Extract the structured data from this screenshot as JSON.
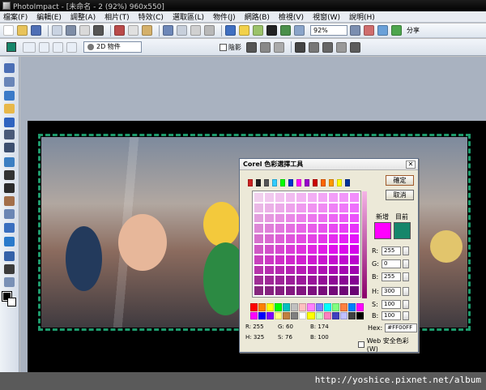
{
  "window": {
    "title": "PhotoImpact - [未命名 - 2 (92%) 960x550]"
  },
  "menu": [
    "檔案(F)",
    "編輯(E)",
    "調整(A)",
    "相片(T)",
    "特效(C)",
    "選取區(L)",
    "物件(J)",
    "網路(B)",
    "檢視(V)",
    "視窗(W)",
    "說明(H)"
  ],
  "toolbar": {
    "zoom_value": "92%",
    "share_label": "分享"
  },
  "attr_toolbar": {
    "object_mode": "2D 物件",
    "shadow_label": "陰影"
  },
  "dialog": {
    "title": "Corel 色彩選擇工具",
    "close_glyph": "✕",
    "ok_label": "確定",
    "cancel_label": "取消",
    "new_label": "新增",
    "current_label": "目前",
    "fields": [
      {
        "label": "R:",
        "value": "255"
      },
      {
        "label": "G:",
        "value": "0"
      },
      {
        "label": "B:",
        "value": "255"
      },
      {
        "label": "H:",
        "value": "300"
      },
      {
        "label": "S:",
        "value": "100"
      },
      {
        "label": "B:",
        "value": "100"
      }
    ],
    "hex_label": "Hex:",
    "hex_value": "#FF00FF",
    "web_safe_label": "Web 安全色彩(W)",
    "info_row1": [
      "R: 255",
      "G: 60",
      "B: 174"
    ],
    "info_row2": [
      "H: 325",
      "S: 76",
      "B: 100"
    ],
    "new_color": "#ff00ff",
    "current_color": "#16866a"
  },
  "watermark": "http://yoshice.pixnet.net/album"
}
